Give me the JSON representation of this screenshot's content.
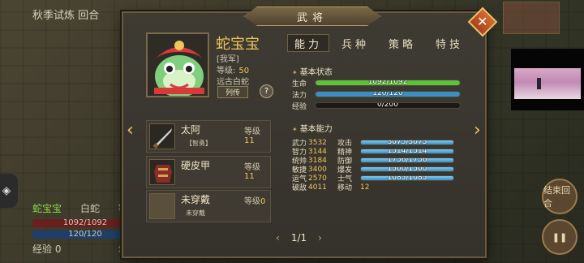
{
  "background": {
    "title": "秋季试炼 回合",
    "unit": {
      "name": "蛇宝宝",
      "type": "白蛇",
      "level_label": "等级",
      "hp": "1092/1092",
      "mp": "120/120",
      "exp_label": "经验 0",
      "in_city": "城内"
    }
  },
  "dialog": {
    "title": "武将",
    "close_icon": "close-icon"
  },
  "general": {
    "name": "蛇宝宝",
    "faction": "[我军]",
    "level_label": "等级:",
    "level_value": "50",
    "origin": "远古白蛇",
    "bio_button": "列传",
    "help_button": "?"
  },
  "tabs": [
    {
      "label": "能力",
      "active": true
    },
    {
      "label": "兵种",
      "active": false
    },
    {
      "label": "策略",
      "active": false
    },
    {
      "label": "特技",
      "active": false
    }
  ],
  "equipment": [
    {
      "name": "太阿",
      "level_label": "等级",
      "level": "11",
      "tag": "【智勇】",
      "icon": "dagger-icon"
    },
    {
      "name": "硬皮甲",
      "level_label": "等级",
      "level": "11",
      "tag": "",
      "icon": "armor-icon"
    },
    {
      "name": "未穿戴",
      "level_label": "等级",
      "level": "0",
      "tag": "未穿戴",
      "icon": "empty-slot-icon"
    }
  ],
  "basic_status": {
    "header": "基本状态",
    "rows": [
      {
        "label": "生命",
        "value": "1092/1092",
        "fraction": 1.0,
        "color": "#5cc23a"
      },
      {
        "label": "法力",
        "value": "120/120",
        "fraction": 1.0,
        "color": "#3b8fc5"
      },
      {
        "label": "经验",
        "value": "0/200",
        "fraction": 0.0,
        "color": "#c9a85a"
      }
    ]
  },
  "basic_ability": {
    "header": "基本能力",
    "rows": [
      {
        "label": "武力",
        "value": "3532",
        "label2": "攻击",
        "bar": "3075/3075",
        "fraction": 1.0
      },
      {
        "label": "智力",
        "value": "3144",
        "label2": "精神",
        "bar": "1514/1514",
        "fraction": 1.0
      },
      {
        "label": "统帅",
        "value": "3184",
        "label2": "防御",
        "bar": "1756/1756",
        "fraction": 1.0
      },
      {
        "label": "敏捷",
        "value": "3400",
        "label2": "爆发",
        "bar": "1500/1500",
        "fraction": 1.0
      },
      {
        "label": "运气",
        "value": "2570",
        "label2": "士气",
        "bar": "1085/1085",
        "fraction": 1.0
      },
      {
        "label": "破敌",
        "value": "4011",
        "label2": "移动",
        "bar": "12",
        "fraction": null
      }
    ]
  },
  "pager": {
    "prev": "‹",
    "text": "1/1",
    "next": "›"
  },
  "nav": {
    "left_arrow": "‹",
    "right_arrow": "›"
  },
  "hud": {
    "end_turn": "结束回合"
  }
}
